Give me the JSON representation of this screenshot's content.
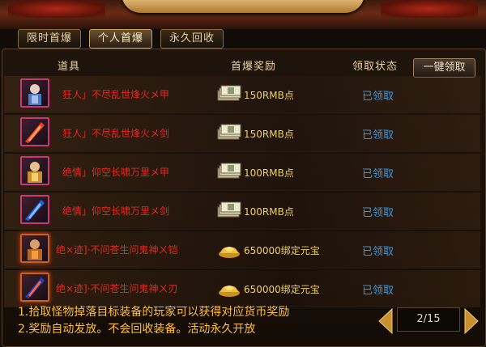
{
  "tabs": [
    {
      "label": "限时首爆",
      "active": false
    },
    {
      "label": "个人首爆",
      "active": true
    },
    {
      "label": "永久回收",
      "active": false
    }
  ],
  "header": {
    "col_item": "道具",
    "col_reward": "首爆奖励",
    "col_status": "领取状态",
    "claim_all": "一键领取"
  },
  "rows": [
    {
      "name": "狂人」不尽乱世烽火メ甲",
      "reward": "150RMB点",
      "reward_icon": "cash-icon",
      "status": "已领取"
    },
    {
      "name": "狂人」不尽乱世烽火メ剑",
      "reward": "150RMB点",
      "reward_icon": "cash-icon",
      "status": "已领取"
    },
    {
      "name": "绝情」仰空长啸万里メ甲",
      "reward": "100RMB点",
      "reward_icon": "cash-icon",
      "status": "已领取"
    },
    {
      "name": "绝情」仰空长啸万里メ剑",
      "reward": "100RMB点",
      "reward_icon": "cash-icon",
      "status": "已领取"
    },
    {
      "name": "绝×迹]·不问苍生问鬼神ㄨ铠",
      "reward": "650000绑定元宝",
      "reward_icon": "gold-ingot-icon",
      "status": "已领取"
    },
    {
      "name": "绝×迹]·不问苍生问鬼神ㄨ刃",
      "reward": "650000绑定元宝",
      "reward_icon": "gold-ingot-icon",
      "status": "已领取"
    }
  ],
  "notes": [
    "1.拾取怪物掉落目标装备的玩家可以获得对应货币奖励",
    "2.奖励自动发放。不会回收装备。活动永久开放"
  ],
  "pager": {
    "current": 2,
    "total": 15,
    "label": "2/15"
  },
  "colors": {
    "item_name": "#e8281e",
    "reward_text": "#f0d060",
    "status_text": "#3a98e0",
    "notes_text": "#ffc030"
  }
}
